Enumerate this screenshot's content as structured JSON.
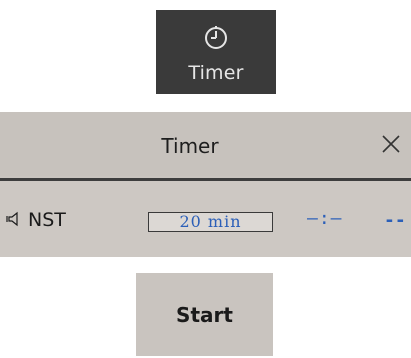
{
  "timer_key": {
    "label": "Timer",
    "icon": "stopwatch-icon"
  },
  "timer_panel": {
    "title": "Timer",
    "close_icon": "close-icon",
    "row": {
      "speaker_icon": "speaker-icon",
      "label": "NST",
      "duration": "20 min",
      "countdown": "—:—",
      "end": "--"
    }
  },
  "start_button": {
    "label": "Start"
  },
  "colors": {
    "key_background": "#3a3a3a",
    "panel_background": "#c9c4bf",
    "value_blue": "#2b5fb8"
  }
}
